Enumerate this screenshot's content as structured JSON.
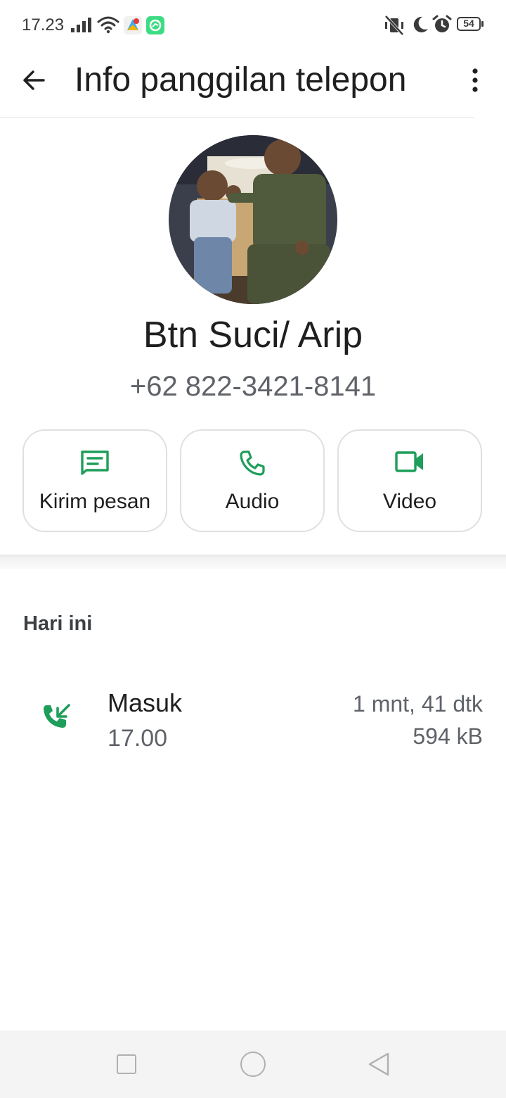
{
  "status_bar": {
    "time": "17.23",
    "battery_level": "54",
    "icons": [
      "signal-icon",
      "wifi-icon",
      "app-notification-icon",
      "app-notification-icon",
      "vibrate-off-icon",
      "moon-icon",
      "alarm-icon",
      "battery-icon"
    ]
  },
  "app_bar": {
    "title": "Info panggilan telepon",
    "back_icon": "arrow-left-icon",
    "menu_icon": "more-vertical-icon"
  },
  "contact": {
    "name": "Btn Suci/ Arip",
    "phone": "+62 822-3421-8141"
  },
  "actions": [
    {
      "label": "Kirim pesan",
      "icon": "message-icon"
    },
    {
      "label": "Audio",
      "icon": "phone-icon"
    },
    {
      "label": "Video",
      "icon": "video-icon"
    }
  ],
  "history": {
    "section_title": "Hari ini",
    "calls": [
      {
        "type": "Masuk",
        "time": "17.00",
        "duration": "1 mnt, 41 dtk",
        "size": "594 kB",
        "icon": "incoming-call-icon"
      }
    ]
  },
  "colors": {
    "accent": "#1e9e5a",
    "text_primary": "#1f1f1f",
    "text_secondary": "#5f6368",
    "navbar_bg": "#f4f4f4"
  }
}
